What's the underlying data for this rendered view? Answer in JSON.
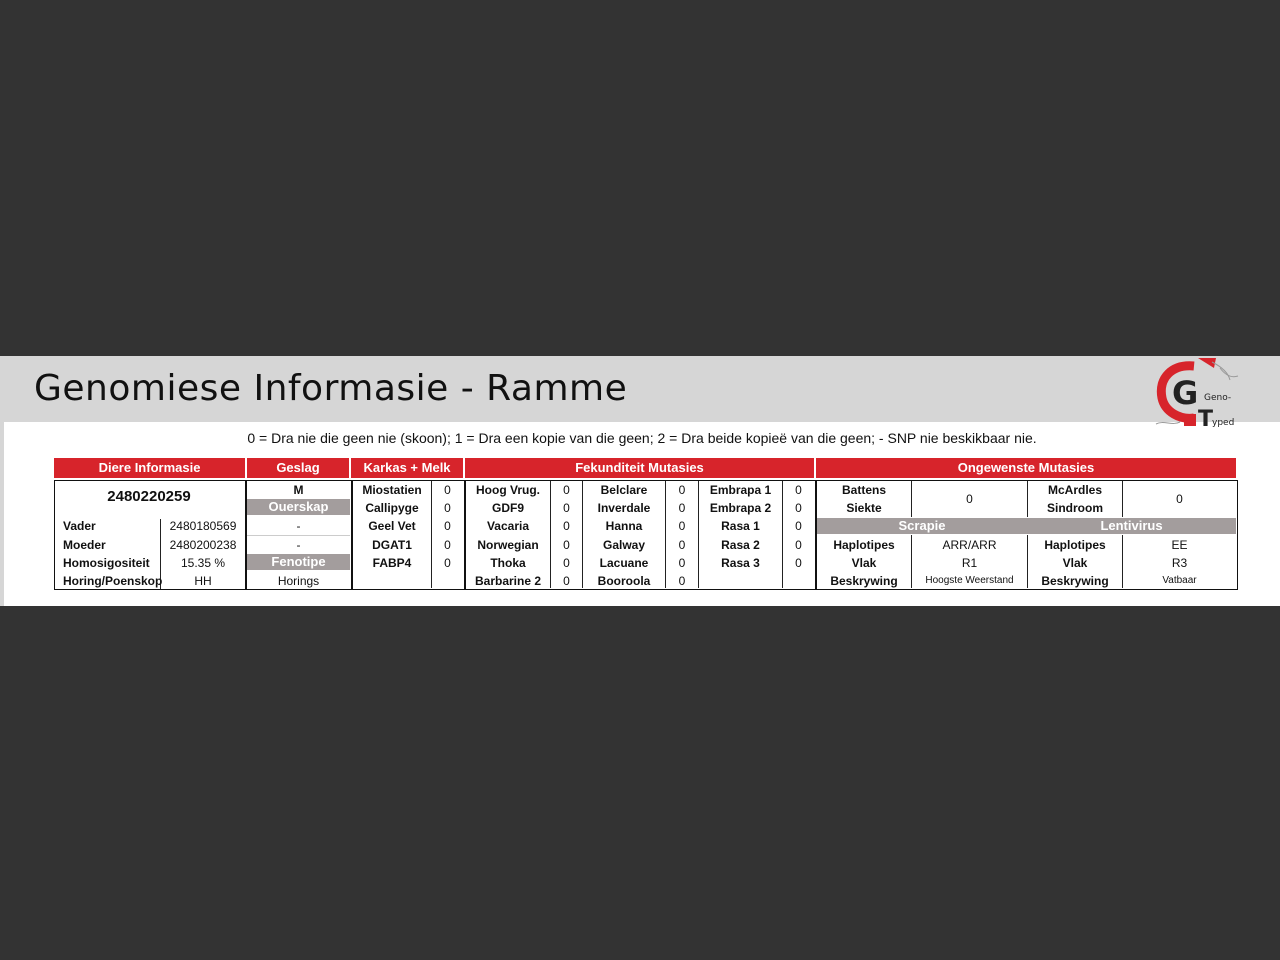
{
  "title": "Genomiese Informasie - Ramme",
  "legend": "0 = Dra nie die geen nie (skoon); 1 = Dra een kopie van die geen; 2 = Dra beide kopieë van die geen; - SNP nie beskikbaar nie.",
  "logo": {
    "letters": "GT",
    "small_top": "Geno-",
    "small_bottom": "yped",
    "colors": {
      "red": "#d7242b",
      "dark": "#222222"
    }
  },
  "colors": {
    "header_red": "#d7242b",
    "subheader_grey": "#a39d9d",
    "title_bar": "#d6d6d6"
  },
  "headers": {
    "diere": "Diere Informasie",
    "geslag": "Geslag",
    "karkas": "Karkas + Melk",
    "fekunditeit": "Fekunditeit Mutasies",
    "ongewenste": "Ongewenste Mutasies"
  },
  "diere": {
    "id": "2480220259",
    "rows": [
      {
        "label": "Vader",
        "value": "2480180569"
      },
      {
        "label": "Moeder",
        "value": "2480200238"
      },
      {
        "label": "Homosigositeit",
        "value": "15.35 %"
      },
      {
        "label": "Horing/Poenskop",
        "value": "HH"
      }
    ]
  },
  "geslag": {
    "value": "M",
    "ouerskap_label": "Ouerskap",
    "ouerskap_vader": "-",
    "ouerskap_moeder": "-",
    "fenotipe_label": "Fenotipe",
    "fenotipe_value": "Horings"
  },
  "karkas": [
    {
      "label": "Miostatien",
      "value": "0"
    },
    {
      "label": "Callipyge",
      "value": "0"
    },
    {
      "label": "Geel Vet",
      "value": "0"
    },
    {
      "label": "DGAT1",
      "value": "0"
    },
    {
      "label": "FABP4",
      "value": "0"
    }
  ],
  "fekunditeit": {
    "col1": [
      {
        "label": "Hoog Vrug.",
        "value": "0"
      },
      {
        "label": "GDF9",
        "value": "0"
      },
      {
        "label": "Vacaria",
        "value": "0"
      },
      {
        "label": "Norwegian",
        "value": "0"
      },
      {
        "label": "Thoka",
        "value": "0"
      },
      {
        "label": "Barbarine 2",
        "value": "0"
      }
    ],
    "col2": [
      {
        "label": "Belclare",
        "value": "0"
      },
      {
        "label": "Inverdale",
        "value": "0"
      },
      {
        "label": "Hanna",
        "value": "0"
      },
      {
        "label": "Galway",
        "value": "0"
      },
      {
        "label": "Lacuane",
        "value": "0"
      },
      {
        "label": "Booroola",
        "value": "0"
      }
    ],
    "col3": [
      {
        "label": "Embrapa 1",
        "value": "0"
      },
      {
        "label": "Embrapa 2",
        "value": "0"
      },
      {
        "label": "Rasa 1",
        "value": "0"
      },
      {
        "label": "Rasa 2",
        "value": "0"
      },
      {
        "label": "Rasa 3",
        "value": "0"
      }
    ]
  },
  "ongewenste": {
    "battens_l1": "Battens",
    "battens_l2": "Siekte",
    "battens_value": "0",
    "mcardles_l1": "McArdles",
    "mcardles_l2": "Sindroom",
    "mcardles_value": "0",
    "scrapie": {
      "title": "Scrapie",
      "haplotipes_label": "Haplotipes",
      "haplotipes": "ARR/ARR",
      "vlak_label": "Vlak",
      "vlak": "R1",
      "beskrywing_label": "Beskrywing",
      "beskrywing": "Hoogste Weerstand"
    },
    "lentivirus": {
      "title": "Lentivirus",
      "haplotipes_label": "Haplotipes",
      "haplotipes": "EE",
      "vlak_label": "Vlak",
      "vlak": "R3",
      "beskrywing_label": "Beskrywing",
      "beskrywing": "Vatbaar"
    }
  }
}
